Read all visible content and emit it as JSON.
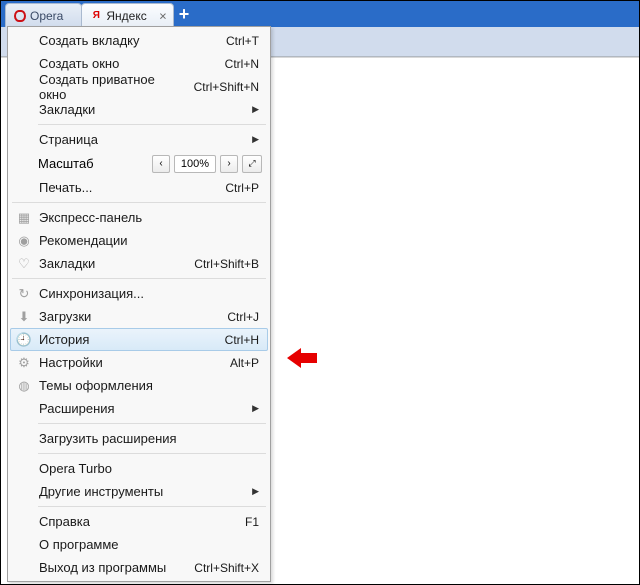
{
  "tabstrip": {
    "tabs": [
      {
        "label": "Opera",
        "active": false
      },
      {
        "label": "Яндекс",
        "active": true
      }
    ],
    "addGlyph": "+"
  },
  "menu": {
    "items": [
      {
        "type": "item",
        "label": "Создать вкладку",
        "shortcut": "Ctrl+T"
      },
      {
        "type": "item",
        "label": "Создать окно",
        "shortcut": "Ctrl+N"
      },
      {
        "type": "item",
        "label": "Создать приватное окно",
        "shortcut": "Ctrl+Shift+N"
      },
      {
        "type": "submenu",
        "label": "Закладки"
      },
      {
        "type": "sep"
      },
      {
        "type": "submenu",
        "label": "Страница"
      },
      {
        "type": "zoom",
        "label": "Масштаб",
        "zoom": {
          "value": "100%",
          "dec": "‹",
          "inc": "›",
          "full": "⤢"
        }
      },
      {
        "type": "item",
        "label": "Печать...",
        "shortcut": "Ctrl+P"
      },
      {
        "type": "sepFull"
      },
      {
        "type": "item",
        "label": "Экспресс-панель",
        "icon": "grid-icon"
      },
      {
        "type": "item",
        "label": "Рекомендации",
        "icon": "eye-icon"
      },
      {
        "type": "item",
        "label": "Закладки",
        "icon": "heart-icon",
        "shortcut": "Ctrl+Shift+B"
      },
      {
        "type": "sepFull"
      },
      {
        "type": "item",
        "label": "Синхронизация...",
        "icon": "sync-icon"
      },
      {
        "type": "item",
        "label": "Загрузки",
        "icon": "download-icon",
        "shortcut": "Ctrl+J"
      },
      {
        "type": "item",
        "label": "История",
        "icon": "history-icon",
        "shortcut": "Ctrl+H",
        "highlight": true
      },
      {
        "type": "item",
        "label": "Настройки",
        "icon": "settings-icon",
        "shortcut": "Alt+P"
      },
      {
        "type": "item",
        "label": "Темы оформления",
        "icon": "theme-icon"
      },
      {
        "type": "submenu",
        "label": "Расширения"
      },
      {
        "type": "sep"
      },
      {
        "type": "item",
        "label": "Загрузить расширения"
      },
      {
        "type": "sep"
      },
      {
        "type": "item",
        "label": "Opera Turbo"
      },
      {
        "type": "submenu",
        "label": "Другие инструменты"
      },
      {
        "type": "sep"
      },
      {
        "type": "item",
        "label": "Справка",
        "shortcut": "F1"
      },
      {
        "type": "item",
        "label": "О программе"
      },
      {
        "type": "item",
        "label": "Выход из программы",
        "shortcut": "Ctrl+Shift+X"
      }
    ]
  },
  "icons": {
    "grid-icon": "▦",
    "eye-icon": "◉",
    "heart-icon": "♡",
    "sync-icon": "↻",
    "download-icon": "⬇",
    "history-icon": "🕘",
    "settings-icon": "⚙",
    "theme-icon": "◍",
    "yandex-icon": "Я"
  }
}
